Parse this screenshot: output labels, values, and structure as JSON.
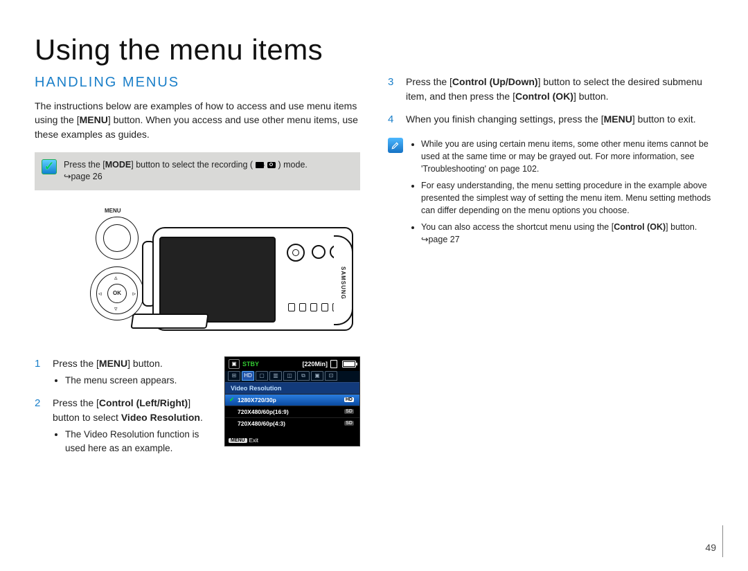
{
  "page": {
    "title": "Using the menu items",
    "section_heading": "HANDLING MENUS",
    "number": "49"
  },
  "left": {
    "intro_parts": [
      "The instructions below are examples of how to access and use menu items using the [",
      "MENU",
      "] button. When you access and use other menu items, use these examples as guides."
    ],
    "mode_note": {
      "pre": "Press the [",
      "bold": "MODE",
      "post": "] button to select the recording ( ",
      "post2": " ) mode.",
      "page_ref": "page 26"
    },
    "camera": {
      "brand": "SAMSUNG",
      "menu_label": "MENU",
      "ok_label": "OK"
    },
    "step1": {
      "text_pre": "Press the [",
      "text_bold": "MENU",
      "text_post": "] button.",
      "bullet": "The menu screen appears."
    },
    "step2": {
      "text_pre": "Press the [",
      "text_bold": "Control (Left/Right)",
      "text_post": "] button to select ",
      "text_bold2": "Video Resolution",
      "text_post2": ".",
      "bullet": "The Video Resolution function is used here as an example."
    }
  },
  "lcd": {
    "stby": "STBY",
    "time": "[220Min]",
    "header": "Video Resolution",
    "rows": [
      {
        "label": "1280X720/30p",
        "badge": "HD",
        "selected": true
      },
      {
        "label": "720X480/60p(16:9)",
        "badge": "SD",
        "selected": false
      },
      {
        "label": "720X480/60p(4:3)",
        "badge": "SD",
        "selected": false
      }
    ],
    "footer_menu": "MENU",
    "footer_exit": "Exit"
  },
  "right": {
    "step3_parts": [
      "Press the [",
      "Control (Up/Down)",
      "] button to select the desired submenu item, and then press the [",
      "Control (OK)",
      "] button."
    ],
    "step4_parts": [
      "When you finish changing settings, press the [",
      "MENU",
      "] button to exit."
    ],
    "tips": [
      "While you are using certain menu items, some other menu items cannot be used at the same time or may be grayed out. For more information, see 'Troubleshooting' on page 102.",
      "For easy understanding, the menu setting procedure in the example above presented the simplest way of setting the menu item. Menu setting methods can differ depending on the menu options you choose."
    ],
    "tip3_parts": [
      "You can also access the shortcut menu using the [",
      "Control (OK)",
      "] button. ",
      "page 27"
    ]
  }
}
